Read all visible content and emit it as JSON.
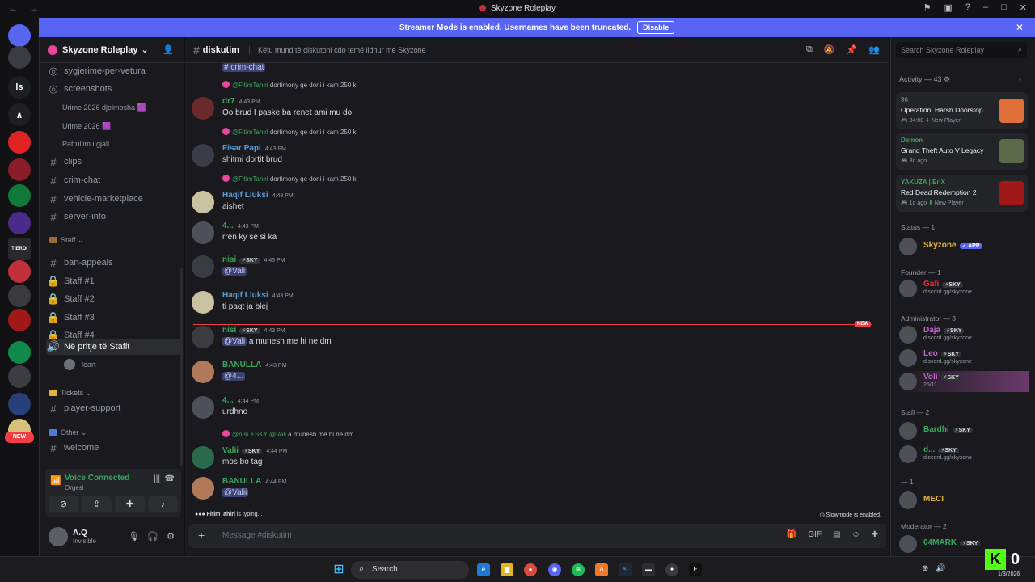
{
  "window": {
    "title": "Skyzone Roleplay"
  },
  "banner": {
    "text": "Streamer Mode is enabled. Usernames have been truncated.",
    "button": "Disable"
  },
  "server_rail": {
    "items": [
      {
        "label": "",
        "badge": "65",
        "color": "#5865f2"
      },
      {
        "label": "",
        "badge": "",
        "color": "#3a3c42"
      },
      {
        "label": "ls",
        "badge": "",
        "color": "#1e1f22"
      },
      {
        "label": "∧",
        "badge": "",
        "color": "#1e1f22"
      },
      {
        "label": "",
        "badge": "",
        "color": "#e02424"
      },
      {
        "label": "",
        "badge": "",
        "color": "#8a1d2a"
      },
      {
        "label": "",
        "badge": "",
        "color": "#0f7a3a"
      },
      {
        "label": "",
        "badge": "1",
        "color": "#4b2a8a"
      },
      {
        "label": "TIERDI",
        "badge": "",
        "color": "#2a2a2e"
      },
      {
        "label": "",
        "badge": "",
        "color": "#c0303a"
      },
      {
        "label": "",
        "badge": "",
        "color": "#3a3a3e"
      },
      {
        "label": "",
        "badge": "18",
        "color": "#a01818"
      },
      {
        "label": "",
        "badge": "",
        "color": "#0f8a4a"
      },
      {
        "label": "",
        "badge": "",
        "color": "#3a3c42"
      },
      {
        "label": "",
        "badge": "",
        "color": "#27407a"
      },
      {
        "label": "",
        "badge": "",
        "color": "#d8c07a"
      }
    ],
    "new_label": "NEW"
  },
  "sidebar": {
    "server_name": "Skyzone Roleplay",
    "channels": [
      {
        "name": "sygjerime-per-vetura",
        "kind": "forum"
      },
      {
        "name": "screenshots",
        "kind": "forum"
      },
      {
        "name": "Urime 2026 djelmosha 🟪",
        "kind": "thread"
      },
      {
        "name": "Urime 2026 🟪",
        "kind": "thread"
      },
      {
        "name": "Patrullim i gjall",
        "kind": "thread"
      },
      {
        "name": "clips",
        "kind": "text"
      },
      {
        "name": "crim-chat",
        "kind": "text"
      },
      {
        "name": "vehicle-marketplace",
        "kind": "text"
      },
      {
        "name": "server-info",
        "kind": "text"
      }
    ],
    "staff_category": "Staff",
    "staff_channels": [
      {
        "name": "ban-appeals",
        "kind": "text"
      },
      {
        "name": "Staff #1",
        "kind": "locked"
      },
      {
        "name": "Staff #2",
        "kind": "locked"
      },
      {
        "name": "Staff #3",
        "kind": "locked"
      },
      {
        "name": "Staff #4",
        "kind": "locked"
      }
    ],
    "voice_channel": "Në pritje të Stafit",
    "voice_user": "leart",
    "tickets_category": "Tickets",
    "tickets_channel": "player-support",
    "other_category": "Other",
    "other_channel": "welcome"
  },
  "voice_panel": {
    "status": "Voice Connected",
    "channel": "Orgesi"
  },
  "user_panel": {
    "name": "A.Q",
    "status": "Invisible"
  },
  "chat": {
    "channel": "diskutim",
    "topic": "Këtu mund të diskutoni cdo temë lidhur me Skyzone",
    "top_mention": "# crim-chat",
    "messages": [
      {
        "reply_to": "@FitimTahiri",
        "reply_text": "dortimony qe doni i kam 250 k",
        "author": "dr7",
        "tag": "",
        "time": "4:43 PM",
        "text": "Oo brud I paske ba renet ami mu do",
        "color": "#3ba55d"
      },
      {
        "reply_to": "@FitimTahiri",
        "reply_text": "dortimony qe doni i kam 250 k",
        "author": "Fisar Papi",
        "tag": "",
        "time": "4:43 PM",
        "text": "shitmi dortit brud",
        "color": "#5b9bd5"
      },
      {
        "reply_to": "@FitimTahiri",
        "reply_text": "dortimony qe doni i kam 250 k",
        "author": "Haqif Lluksi",
        "tag": "",
        "time": "4:43 PM",
        "text": "aishet",
        "color": "#5b9bd5"
      },
      {
        "reply_to": "",
        "reply_text": "",
        "author": "4...",
        "tag": "",
        "time": "4:43 PM",
        "text": "rren ky se si ka",
        "color": "#3ba55d"
      },
      {
        "reply_to": "",
        "reply_text": "",
        "author": "nisi",
        "tag": "⚡SKY",
        "time": "4:43 PM",
        "text": "@Vali",
        "color": "#3ba55d"
      },
      {
        "reply_to": "",
        "reply_text": "",
        "author": "Haqif Lluksi",
        "tag": "",
        "time": "4:43 PM",
        "text": "ti paqt ja blej",
        "color": "#5b9bd5"
      },
      {
        "reply_to": "",
        "reply_text": "",
        "author": "nisi",
        "tag": "⚡SKY",
        "time": "4:43 PM",
        "text": "@Vali a munesh me hi ne dm",
        "color": "#3ba55d"
      },
      {
        "reply_to": "",
        "reply_text": "",
        "author": "BANULLA",
        "tag": "",
        "time": "4:43 PM",
        "text": "@4...",
        "color": "#3ba55d"
      },
      {
        "reply_to": "",
        "reply_text": "",
        "author": "4...",
        "tag": "",
        "time": "4:44 PM",
        "text": "urdhno",
        "color": "#3ba55d"
      },
      {
        "reply_to": "@nisi ⚡SKY @Vali",
        "reply_text": "a munesh me hi ne dm",
        "author": "Valii",
        "tag": "⚡SKY",
        "time": "4:44 PM",
        "text": "mos bo tag",
        "color": "#3ba55d"
      },
      {
        "reply_to": "",
        "reply_text": "",
        "author": "BANULLA",
        "tag": "",
        "time": "4:44 PM",
        "text": "@Valii",
        "color": "#3ba55d"
      }
    ],
    "new_label": "NEW",
    "typing_user": "FitimTahiri",
    "typing_text": "is typing...",
    "slowmode": "Slowmode is enabled.",
    "composer_placeholder": "Message #diskutim"
  },
  "members": {
    "search_placeholder": "Search Skyzone Roleplay",
    "activity_header": "Activity — 43",
    "activities": [
      {
        "user": "96",
        "game": "Operation: Harsh Doorstop",
        "time": "34:00",
        "extra": "New Player",
        "art": "#e0703a"
      },
      {
        "user": "Demon",
        "game": "Grand Theft Auto V Legacy",
        "time": "3d ago",
        "extra": "",
        "art": "#5a6a4a"
      },
      {
        "user": "YAKUZA | EriX",
        "game": "Red Dead Redemption 2",
        "time": "1d ago",
        "extra": "New Player",
        "art": "#a01818"
      }
    ],
    "groups": [
      {
        "title": "Status — 1",
        "members": [
          {
            "name": "Skyzone",
            "tag": "✓ APP",
            "sub": "",
            "color": "#e3b341"
          }
        ]
      },
      {
        "title": "Founder — 1",
        "members": [
          {
            "name": "Gafi",
            "tag": "⚡SKY",
            "sub": "discord.gg/skyzone",
            "color": "#e3323e"
          }
        ]
      },
      {
        "title": "Administrator — 3",
        "members": [
          {
            "name": "Daja",
            "tag": "⚡SKY",
            "sub": "discord.gg/skyzone",
            "color": "#c066cc"
          },
          {
            "name": "Leo",
            "tag": "⚡SKY",
            "sub": "discord.gg/skyzone",
            "color": "#c066cc"
          },
          {
            "name": "Voli",
            "tag": "⚡SKY",
            "sub": "25/11",
            "color": "#c066cc"
          }
        ]
      },
      {
        "title": "Staff — 2",
        "members": [
          {
            "name": "Bardhi",
            "tag": "⚡SKY",
            "sub": "",
            "color": "#3ba55d"
          },
          {
            "name": "d...",
            "tag": "⚡SKY",
            "sub": "discord.gg/skyzone",
            "color": "#3ba55d"
          }
        ]
      },
      {
        "title": "— 1",
        "members": [
          {
            "name": "MECI",
            "tag": "",
            "sub": "",
            "color": "#e3b341"
          }
        ]
      },
      {
        "title": "Moderator — 2",
        "members": [
          {
            "name": "04MARK",
            "tag": "⚡SKY",
            "sub": "",
            "color": "#3ba55d"
          }
        ]
      }
    ]
  },
  "taskbar": {
    "search": "Search",
    "date": "1/3/2026",
    "kick_count": "0"
  }
}
